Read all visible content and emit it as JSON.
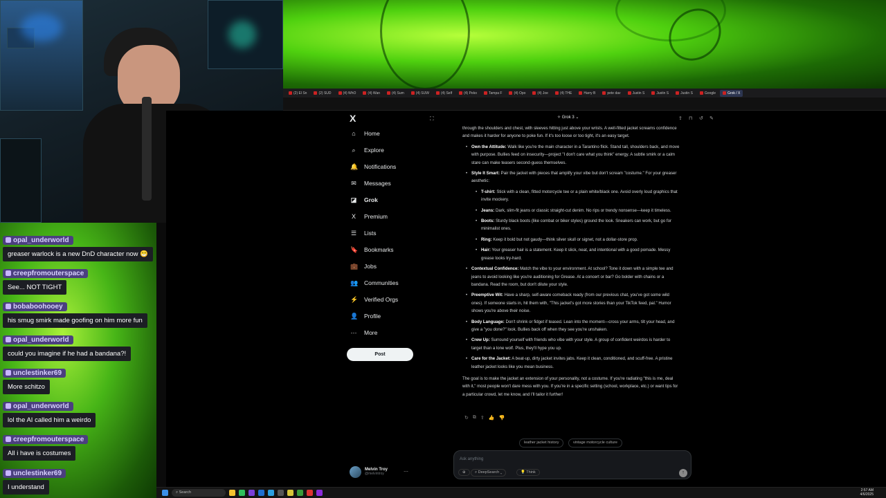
{
  "chat": {
    "messages": [
      {
        "user": "opal_underworld",
        "text": "greaser warlock is a new DnD character now 😁"
      },
      {
        "user": "creepfromouterspace",
        "text": "See... NOT TIGHT"
      },
      {
        "user": "bobaboohooey",
        "text": "his smug smirk made goofing on him more fun"
      },
      {
        "user": "opal_underworld",
        "text": "could you imagine if he had a bandana?!"
      },
      {
        "user": "unclestinker69",
        "text": "More schitzo"
      },
      {
        "user": "opal_underworld",
        "text": "lol the AI called him a weirdo"
      },
      {
        "user": "creepfromouterspace",
        "text": "All i have is costumes"
      },
      {
        "user": "unclestinker69",
        "text": "I understand"
      }
    ]
  },
  "browser": {
    "tabs": [
      "(2) El Sn",
      "(2) SUD",
      "(4) WhO",
      "(4) Wan",
      "(4) Sum",
      "(4) SUW",
      "(4) Self",
      "(4) Peko",
      "Tampa F",
      "(4) Opo",
      "(4) Joe",
      "(4) THE",
      "Harry B",
      "pete dav",
      "Justin S",
      "Justin S",
      "Justin S",
      "Google",
      "Grok / X"
    ]
  },
  "nav": {
    "logo": "X",
    "items": [
      {
        "label": "Home",
        "icon": "⌂"
      },
      {
        "label": "Explore",
        "icon": "⌕"
      },
      {
        "label": "Notifications",
        "icon": "🔔"
      },
      {
        "label": "Messages",
        "icon": "✉"
      },
      {
        "label": "Grok",
        "icon": "◪"
      },
      {
        "label": "Premium",
        "icon": "X"
      },
      {
        "label": "Lists",
        "icon": "☰"
      },
      {
        "label": "Bookmarks",
        "icon": "🔖"
      },
      {
        "label": "Jobs",
        "icon": "💼"
      },
      {
        "label": "Communities",
        "icon": "👥"
      },
      {
        "label": "Verified Orgs",
        "icon": "⚡"
      },
      {
        "label": "Profile",
        "icon": "👤"
      },
      {
        "label": "More",
        "icon": "⋯"
      }
    ],
    "post": "Post",
    "profile_name": "Melvin Troy",
    "profile_handle": "@melvintroy"
  },
  "grok": {
    "header": "Grok 3",
    "p1_tail": "through the shoulders and chest, with sleeves hitting just above your wrists. A well-fitted jacket screams confidence and makes it harder for anyone to poke fun. If it's too loose or too tight, it's an easy target.",
    "b1_title": "Own the Attitude:",
    "b1_text": " Walk like you're the main character in a Tarantino flick. Stand tall, shoulders back, and move with purpose. Bullies feed on insecurity—project \"I don't care what you think\" energy. A subtle smirk or a calm stare can make teasers second-guess themselves.",
    "b2_title": "Style It Smart:",
    "b2_text": " Pair the jacket with pieces that amplify your vibe but don't scream \"costume.\" For your greaser aesthetic:",
    "s1_title": "T-shirt:",
    "s1_text": " Stick with a clean, fitted motorcycle tee or a plain white/black one. Avoid overly loud graphics that invite mockery.",
    "s2_title": "Jeans:",
    "s2_text": " Dark, slim-fit jeans or classic straight-cut denim. No rips or trendy nonsense—keep it timeless.",
    "s3_title": "Boots:",
    "s3_text": " Sturdy black boots (like combat or biker styles) ground the look. Sneakers can work, but go for minimalist ones.",
    "s4_title": "Ring:",
    "s4_text": " Keep it bold but not gaudy—think silver skull or signet, not a dollar-store prop.",
    "s5_title": "Hair:",
    "s5_text": " Your greaser hair is a statement. Keep it slick, neat, and intentional with a good pomade. Messy grease looks try-hard.",
    "b3_title": "Contextual Confidence:",
    "b3_text": " Match the vibe to your environment. At school? Tone it down with a simple tee and jeans to avoid looking like you're auditioning for Grease. At a concert or bar? Go bolder with chains or a bandana. Read the room, but don't dilute your style.",
    "b4_title": "Preemptive Wit:",
    "b4_text": " Have a sharp, self-aware comeback ready (from our previous chat, you've got some wild ones). If someone starts in, hit them with, \"This jacket's got more stories than your TikTok feed, pal.\" Humor shows you're above their noise.",
    "b5_title": "Body Language:",
    "b5_text": " Don't shrink or fidget if teased. Lean into the moment—cross your arms, tilt your head, and give a \"you done?\" look. Bullies back off when they see you're unshaken.",
    "b6_title": "Crew Up:",
    "b6_text": " Surround yourself with friends who vibe with your style. A group of confident weirdos is harder to target than a lone wolf. Plus, they'll hype you up.",
    "b7_title": "Care for the Jacket:",
    "b7_text": " A beat-up, dirty jacket invites jabs. Keep it clean, conditioned, and scuff-free. A pristine leather jacket looks like you mean business.",
    "closing": "The goal is to make the jacket an extension of your personality, not a costume. If you're radiating \"this is me, deal with it,\" most people won't dare mess with you. If you're in a specific setting (school, workplace, etc.) or want tips for a particular crowd, let me know, and I'll tailor it further!",
    "chip1": "leather jacket history",
    "chip2": "vintage motorcycle culture",
    "input_placeholder": "Ask anything",
    "deepsearch": "DeepSearch",
    "think": "Think"
  },
  "taskbar": {
    "search": "Search",
    "time": "2:57 AM",
    "date": "4/6/2025"
  }
}
